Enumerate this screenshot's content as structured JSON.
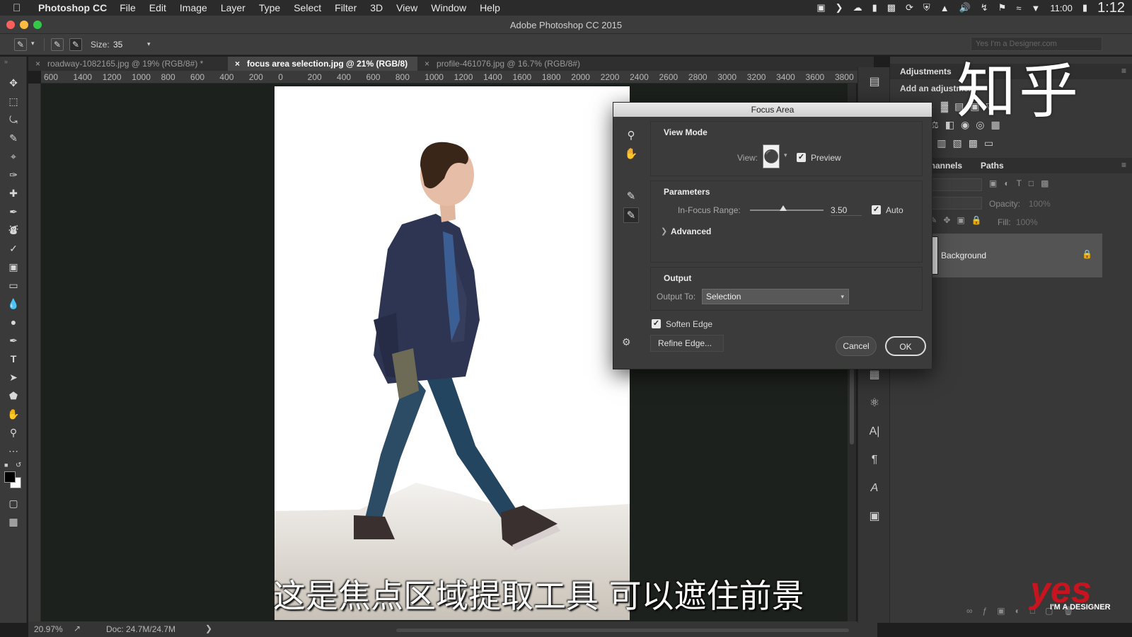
{
  "menubar": {
    "app_name": "Photoshop CC",
    "items": [
      "File",
      "Edit",
      "Image",
      "Layer",
      "Type",
      "Select",
      "Filter",
      "3D",
      "View",
      "Window",
      "Help"
    ],
    "clock": "11:00",
    "overlay_time": "1:12"
  },
  "window": {
    "title": "Adobe Photoshop CC 2015"
  },
  "options_bar": {
    "size_label": "Size:",
    "size_value": "35",
    "search_placeholder": "Yes I'm a Designer.com"
  },
  "tabs": [
    {
      "label": "roadway-1082165.jpg @ 19% (RGB/8#) *",
      "active": false
    },
    {
      "label": "focus area selection.jpg @ 21% (RGB/8)",
      "active": true
    },
    {
      "label": "profile-461076.jpg @ 16.7% (RGB/8#)",
      "active": false
    }
  ],
  "ruler": {
    "labels": [
      "600",
      "1400",
      "1200",
      "1000",
      "800",
      "600",
      "400",
      "200",
      "0",
      "200",
      "400",
      "600",
      "800",
      "1000",
      "1200",
      "1400",
      "1600",
      "1800",
      "2000",
      "2200",
      "2400",
      "2600",
      "2800",
      "3000",
      "3200",
      "3400",
      "3600",
      "3800"
    ]
  },
  "status": {
    "zoom": "20.97%",
    "doc": "Doc: 24.7M/24.7M"
  },
  "panels": {
    "adjustments_title": "Adjustments",
    "adjustments_hint": "Add an adjustment",
    "channels_tab": "Channels",
    "paths_tab": "Paths",
    "opacity_label": "Opacity:",
    "opacity_value": "100%",
    "fill_label": "Fill:",
    "fill_value": "100%",
    "layer_name": "Background"
  },
  "dialog": {
    "title": "Focus Area",
    "view_mode_title": "View Mode",
    "view_label": "View:",
    "preview_label": "Preview",
    "preview_checked": true,
    "parameters_title": "Parameters",
    "in_focus_label": "In-Focus Range:",
    "in_focus_value": "3.50",
    "in_focus_fraction": 0.45,
    "auto_label": "Auto",
    "auto_checked": true,
    "advanced_label": "Advanced",
    "output_title": "Output",
    "output_to_label": "Output To:",
    "output_to_value": "Selection",
    "soften_edge_label": "Soften Edge",
    "soften_edge_checked": true,
    "refine_edge_label": "Refine Edge...",
    "cancel_label": "Cancel",
    "ok_label": "OK"
  },
  "overlay": {
    "zhihu_watermark": "知乎",
    "subtitle": "这是焦点区域提取工具  可以遮住前景",
    "brand_logo": "yes",
    "brand_tagline": "I'M A DESIGNER"
  },
  "colors": {
    "canvas_bg": "#1d211d",
    "panel_bg": "#383838",
    "brand_red": "#c8141e"
  }
}
